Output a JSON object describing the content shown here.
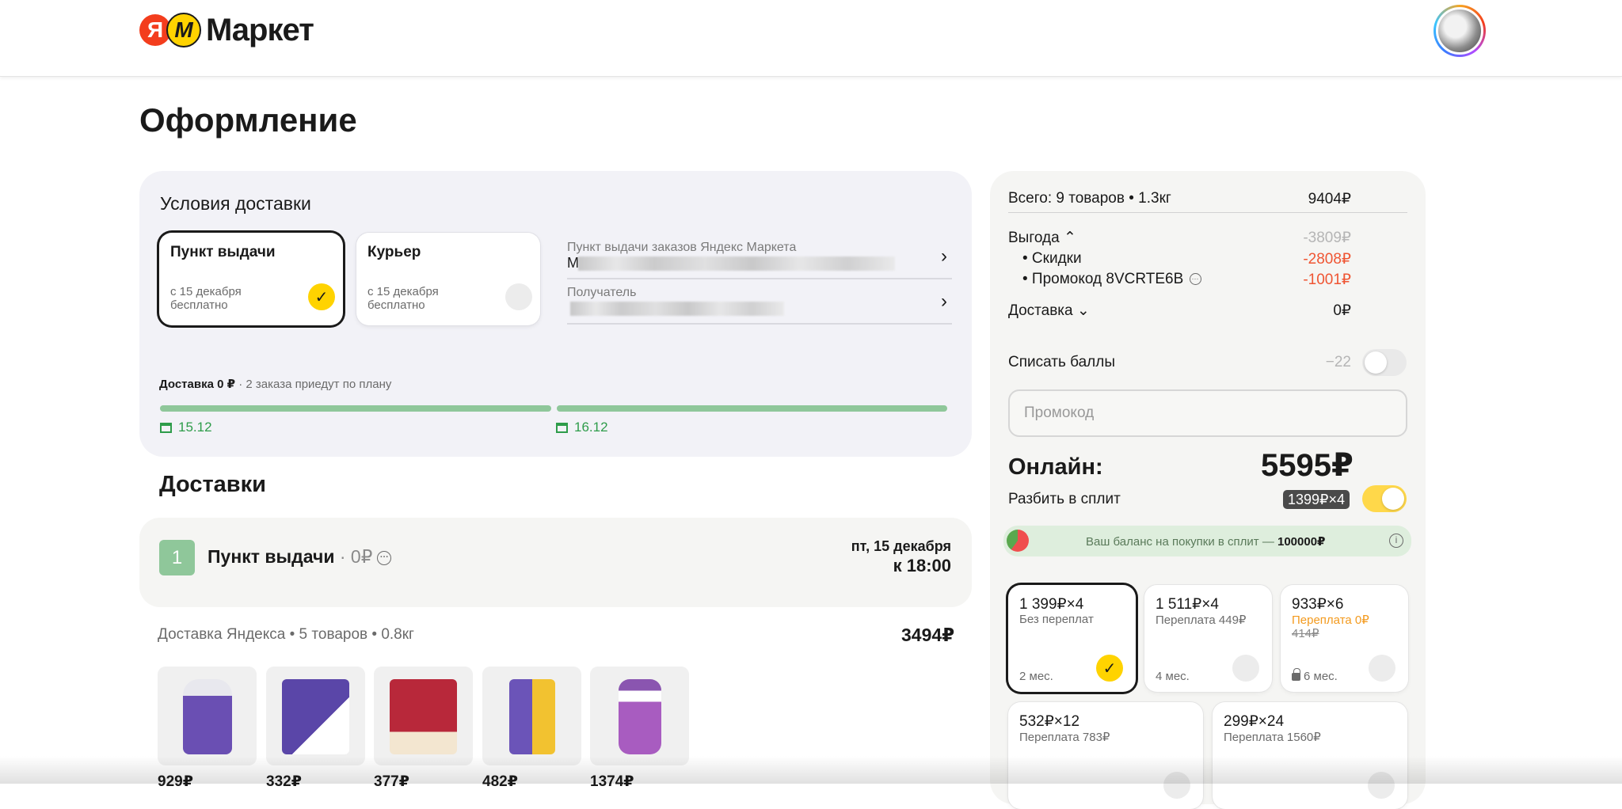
{
  "header": {
    "logo_ya": "Я",
    "logo_m": "M",
    "logo_text": "Маркет"
  },
  "page_title": "Оформление",
  "delivery_conditions": {
    "title": "Условия доставки",
    "options": [
      {
        "title": "Пункт выдачи",
        "date": "с 15 декабря",
        "price": "бесплатно",
        "selected": true
      },
      {
        "title": "Курьер",
        "date": "с 15 декабря",
        "price": "бесплатно",
        "selected": false
      }
    ],
    "pickup_label": "Пункт выдачи заказов Яндекс Маркета",
    "pickup_value_visible": "М",
    "recipient_label": "Получатель",
    "summary_bold": "Доставка 0 ₽",
    "summary_rest": " · 2 заказа приедут по плану",
    "dates": [
      "15.12",
      "16.12"
    ]
  },
  "deliveries": {
    "title": "Доставки",
    "card": {
      "number": "1",
      "name": "Пункт выдачи",
      "price": " · 0₽",
      "date_line1": "пт, 15 декабря",
      "date_line2": "к 18:00"
    },
    "shipping_line": "Доставка Яндекса • 5 товаров • 0.8кг",
    "shipping_total": "3494₽",
    "products": [
      {
        "price": "929₽",
        "color": "#6a4fb3"
      },
      {
        "price": "332₽",
        "color": "#5a46a8"
      },
      {
        "price": "377₽",
        "color": "#b8283a"
      },
      {
        "price": "482₽",
        "color": "#6b54b8"
      },
      {
        "price": "1374₽",
        "color": "#a85cc0"
      }
    ]
  },
  "summary": {
    "total_label": "Всего: 9 товаров • 1.3кг",
    "total_value": "9404₽",
    "benefit_label": "Выгода",
    "benefit_value": "-3809₽",
    "discounts_label": "• Скидки",
    "discounts_value": "-2808₽",
    "promo_line_label": "• Промокод 8VCRTE6B",
    "promo_line_value": "-1001₽",
    "delivery_label": "Доставка",
    "delivery_value": "0₽",
    "points_label": "Списать баллы",
    "points_value": "−22",
    "promo_placeholder": "Промокод",
    "online_label": "Онлайн:",
    "online_value": "5595₽",
    "split_label": "Разбить в сплит",
    "split_chip": "1399₽×4",
    "balance_text": "Ваш баланс на покупки в сплит — ",
    "balance_value": "100000₽",
    "plans": [
      {
        "amount": "1 399₽×4",
        "sub": "Без переплат",
        "term": "2 мес.",
        "selected": true
      },
      {
        "amount": "1 511₽×4",
        "sub": "Переплата 449₽",
        "term": "4 мес.",
        "selected": false
      },
      {
        "amount": "933₽×6",
        "sub": "Переплата 0₽",
        "strike": "414₽",
        "term": "6 мес.",
        "selected": false
      },
      {
        "amount": "532₽×12",
        "sub": "Переплата 783₽",
        "selected": false
      },
      {
        "amount": "299₽×24",
        "sub": "Переплата 1560₽",
        "selected": false
      }
    ]
  }
}
